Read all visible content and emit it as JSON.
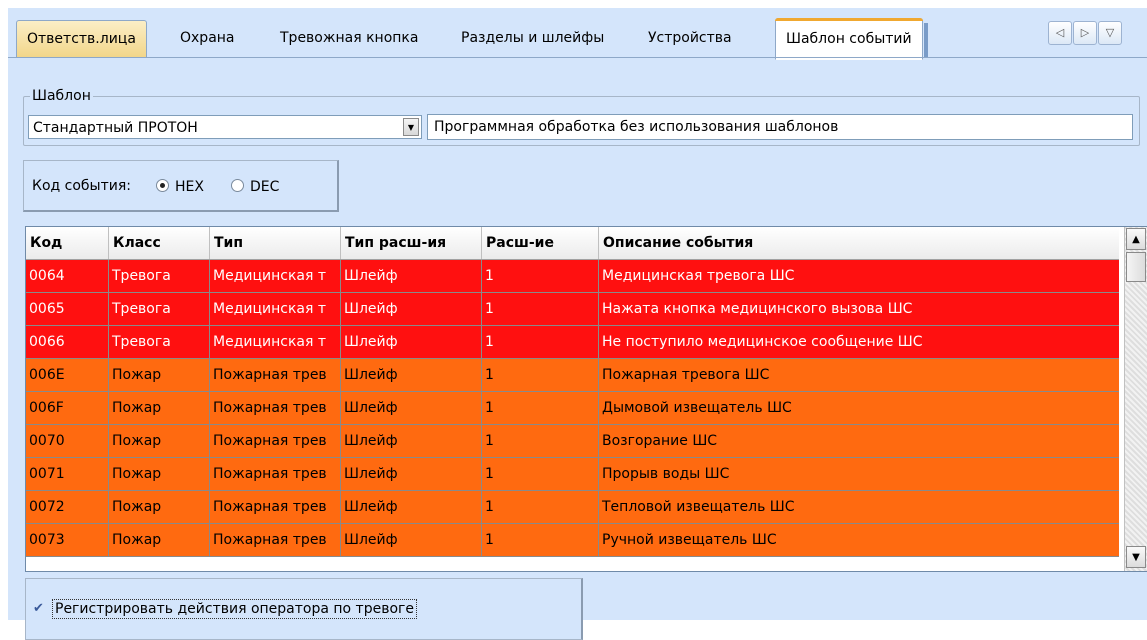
{
  "tabs": [
    {
      "label": "Ответств.лица",
      "state": "first"
    },
    {
      "label": "Охрана",
      "state": "normal"
    },
    {
      "label": "Тревожная кнопка",
      "state": "normal"
    },
    {
      "label": "Разделы и шлейфы",
      "state": "normal"
    },
    {
      "label": "Устройства",
      "state": "normal"
    },
    {
      "label": "Шаблон событий",
      "state": "active"
    }
  ],
  "nav": {
    "prev_icon": "◁",
    "next_icon": "▷",
    "menu_icon": "▽"
  },
  "template": {
    "legend": "Шаблон",
    "selected": "Стандартный ПРОТОН",
    "description": "Программная обработка без использования шаблонов"
  },
  "event_code": {
    "label": "Код события:",
    "options": [
      {
        "label": "HEX",
        "checked": true
      },
      {
        "label": "DEC",
        "checked": false
      }
    ]
  },
  "table": {
    "columns": [
      "Код",
      "Класс",
      "Тип",
      "Тип расш-ия",
      "Расш-ие",
      "Описание события"
    ],
    "rows": [
      {
        "style": "red",
        "cells": [
          "0064",
          "Тревога",
          "Медицинская т",
          "Шлейф",
          "1",
          "Медицинская тревога ШС"
        ]
      },
      {
        "style": "red",
        "cells": [
          "0065",
          "Тревога",
          "Медицинская т",
          "Шлейф",
          "1",
          "Нажата кнопка медицинского вызова ШС"
        ]
      },
      {
        "style": "red",
        "cells": [
          "0066",
          "Тревога",
          "Медицинская т",
          "Шлейф",
          "1",
          "Не поступило медицинское сообщение ШС"
        ]
      },
      {
        "style": "orange",
        "cells": [
          "006E",
          "Пожар",
          "Пожарная трев",
          "Шлейф",
          "1",
          "Пожарная тревога ШС"
        ]
      },
      {
        "style": "orange",
        "cells": [
          "006F",
          "Пожар",
          "Пожарная трев",
          "Шлейф",
          "1",
          "Дымовой извещатель ШС"
        ]
      },
      {
        "style": "orange",
        "cells": [
          "0070",
          "Пожар",
          "Пожарная трев",
          "Шлейф",
          "1",
          "Возгорание ШС"
        ]
      },
      {
        "style": "orange",
        "cells": [
          "0071",
          "Пожар",
          "Пожарная трев",
          "Шлейф",
          "1",
          "Прорыв воды ШС"
        ]
      },
      {
        "style": "orange",
        "cells": [
          "0072",
          "Пожар",
          "Пожарная трев",
          "Шлейф",
          "1",
          "Тепловой извещатель ШС"
        ]
      },
      {
        "style": "orange",
        "cells": [
          "0073",
          "Пожар",
          "Пожарная трев",
          "Шлейф",
          "1",
          "Ручной извещатель ШС"
        ]
      }
    ]
  },
  "row_colors": {
    "red": "#ff1010",
    "orange": "#ff6a10"
  },
  "register_checkbox": {
    "label": "Регистрировать действия оператора по тревоге",
    "checked": true,
    "check_glyph": "✔"
  },
  "scroll_icons": {
    "up": "▲",
    "down": "▼"
  },
  "combo_arrow": "▼"
}
